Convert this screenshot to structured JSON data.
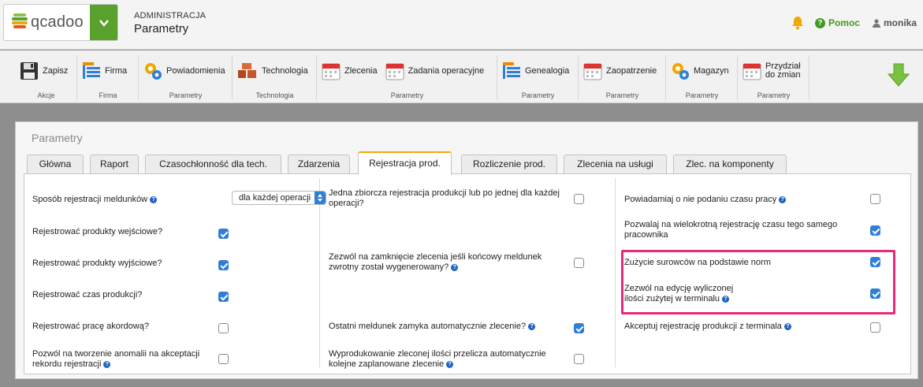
{
  "app": {
    "logo": "qcadoo",
    "section": "ADMINISTRACJA",
    "title": "Parametry"
  },
  "header": {
    "help_label": "Pomoc",
    "user_name": "monika"
  },
  "ribbon": {
    "groups": [
      {
        "label": "Akcje",
        "buttons": [
          {
            "label": "Zapisz",
            "icon": "save-icon"
          }
        ]
      },
      {
        "label": "Firma",
        "buttons": [
          {
            "label": "Firma",
            "icon": "list-icon"
          }
        ]
      },
      {
        "label": "Parametry",
        "buttons": [
          {
            "label": "Powiadomienia",
            "icon": "gears-icon"
          }
        ]
      },
      {
        "label": "Technologia",
        "buttons": [
          {
            "label": "Technologia",
            "icon": "bricks-icon"
          }
        ]
      },
      {
        "label": "Parametry",
        "buttons": [
          {
            "label": "Zlecenia",
            "icon": "calendar-icon"
          },
          {
            "label": "Zadania operacyjne",
            "icon": "calendar-icon"
          }
        ]
      },
      {
        "label": "Parametry",
        "buttons": [
          {
            "label": "Genealogia",
            "icon": "list-icon"
          }
        ]
      },
      {
        "label": "Parametry",
        "buttons": [
          {
            "label": "Zaopatrzenie",
            "icon": "calendar-icon"
          }
        ]
      },
      {
        "label": "Parametry",
        "buttons": [
          {
            "label": "Magazyn",
            "icon": "gears-icon"
          }
        ]
      },
      {
        "label": "Parametry",
        "buttons": [
          {
            "label": "Przydział\ndo zmian",
            "icon": "calendar-icon"
          }
        ]
      }
    ]
  },
  "panel": {
    "title": "Parametry",
    "tabs": [
      "Główna",
      "Raport",
      "Czasochłonność dla tech.",
      "Zdarzenia",
      "Rejestracja prod.",
      "Rozliczenie prod.",
      "Zlecenia na usługi",
      "Zlec. na komponenty"
    ],
    "active_tab": 4
  },
  "select": {
    "label": "Sposób rejestracji meldunków",
    "value": "dla każdej operacji"
  },
  "fields": {
    "left": [
      {
        "label": "Rejestrować produkty wejściowe?",
        "checked": true,
        "help": false
      },
      {
        "label": "Rejestrować produkty wyjściowe?",
        "checked": true,
        "help": false
      },
      {
        "label": "Rejestrować czas produkcji?",
        "checked": true,
        "help": false
      },
      {
        "label": "Rejestrować pracę akordową?",
        "checked": false,
        "help": false
      },
      {
        "label": "Pozwól na tworzenie anomalii na akceptacji rekordu rejestracji",
        "checked": false,
        "help": true
      }
    ],
    "middle": [
      {
        "label": "Jedna zbiorcza rejestracja produkcji lub po jednej dla każdej operacji?",
        "checked": false,
        "help": false
      },
      {
        "label": "Zezwól na zamknięcie zlecenia jeśli końcowy meldunek zwrotny został wygenerowany?",
        "checked": false,
        "help": true
      },
      {
        "label": "Ostatni meldunek zamyka automatycznie zlecenie?",
        "checked": true,
        "help": true
      },
      {
        "label": "Wyprodukowanie zleconej ilości przelicza automatycznie kolejne zaplanowane zlecenie",
        "checked": false,
        "help": true
      }
    ],
    "right": [
      {
        "label": "Powiadamiaj o nie podaniu czasu pracy",
        "checked": false,
        "help": true
      },
      {
        "label": "Pozwalaj na wielokrotną rejestrację czasu tego samego pracownika",
        "checked": true,
        "help": false
      },
      {
        "label": "Zużycie surowców na podstawie norm",
        "checked": true,
        "help": false
      },
      {
        "label": "Zezwól na edycję wyliczonej\nilości zużytej w terminalu",
        "checked": true,
        "help": true
      },
      {
        "label": "Akceptuj rejestrację produkcji z terminala",
        "checked": false,
        "help": true
      }
    ]
  },
  "colors": {
    "accent": "#2f7ed8",
    "brand": "#5aa02c",
    "highlight": "#e8287a",
    "active_tab": "#f0a800"
  }
}
